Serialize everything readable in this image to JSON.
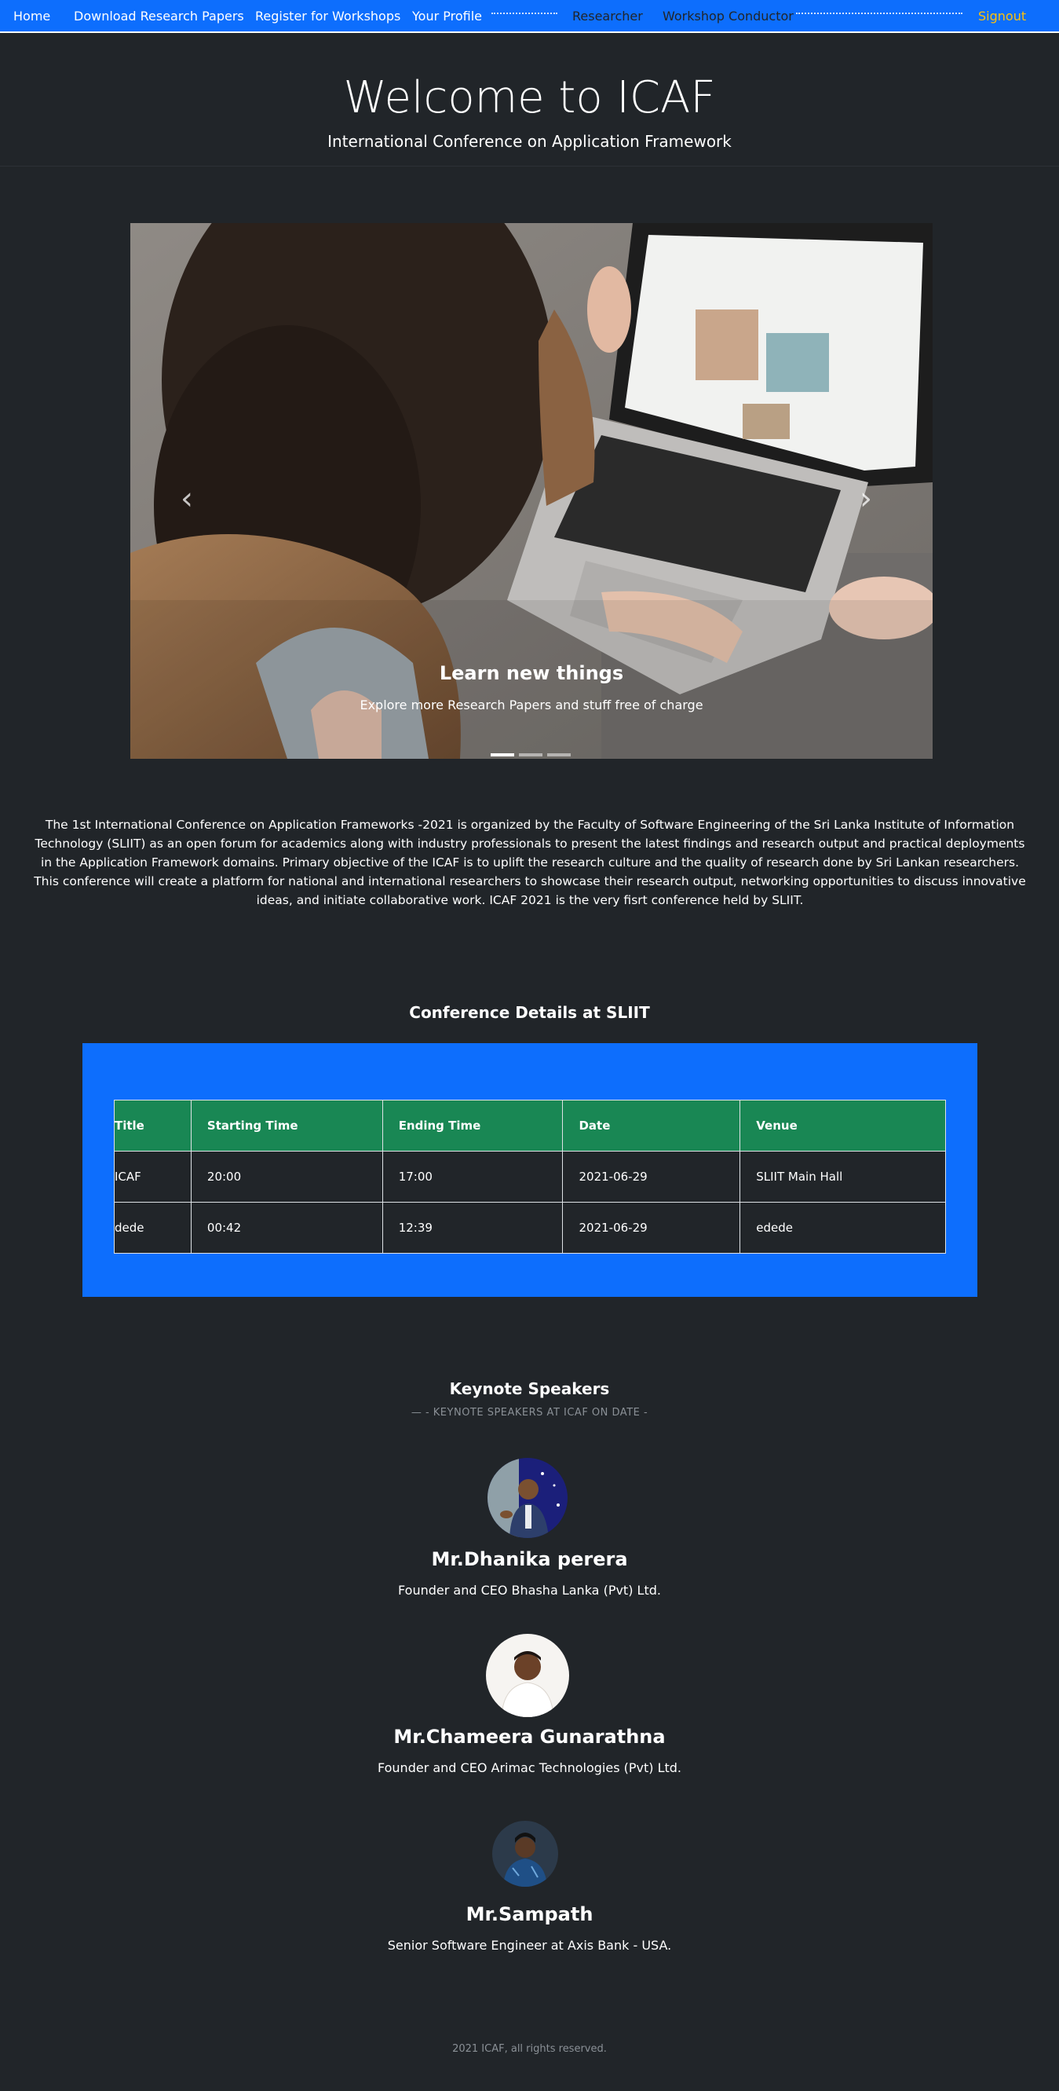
{
  "nav": {
    "home": "Home",
    "download": "Download Research Papers",
    "register": "Register for Workshops",
    "profile": "Your Profile",
    "researcher": "Researcher",
    "conductor": "Workshop Conductor",
    "signout": "Signout"
  },
  "hero": {
    "title": "Welcome to ICAF",
    "subtitle": "International Conference on Application Framework"
  },
  "carousel": {
    "caption_title": "Learn new things",
    "caption_text": "Explore more Research Papers and stuff free of charge",
    "prev_icon": "‹",
    "next_icon": "›",
    "active_index": 0,
    "slide_count": 3
  },
  "intro": "The 1st International Conference on Application Frameworks -2021 is organized by the Faculty of Software Engineering of the Sri Lanka Institute of Information Technology (SLIIT) as an open forum for academics along with industry professionals to present the latest findings and research output and practical deployments in the Application Framework domains. Primary objective of the ICAF is to uplift the research culture and the quality of research done by Sri Lankan researchers. This conference will create a platform for national and international researchers to showcase their research output, networking opportunities to discuss innovative ideas, and initiate collaborative work. ICAF 2021 is the very fisrt conference held by SLIIT.",
  "conference": {
    "title": "Conference Details at SLIIT",
    "headers": [
      "Title",
      "Starting Time",
      "Ending Time",
      "Date",
      "Venue"
    ],
    "rows": [
      [
        "ICAF",
        "20:00",
        "17:00",
        "2021-06-29",
        "SLIIT Main Hall"
      ],
      [
        "dede",
        "00:42",
        "12:39",
        "2021-06-29",
        "edede"
      ]
    ]
  },
  "keynote": {
    "title": "Keynote Speakers",
    "subtitle": "— - KEYNOTE SPEAKERS AT ICAF ON DATE -",
    "speakers": [
      {
        "name": "Mr.Dhanika perera",
        "role": "Founder and CEO Bhasha Lanka (Pvt) Ltd."
      },
      {
        "name": "Mr.Chameera Gunarathna",
        "role": "Founder and CEO Arimac Technologies (Pvt) Ltd."
      },
      {
        "name": "Mr.Sampath",
        "role": "Senior Software Engineer at Axis Bank - USA."
      }
    ]
  },
  "footer": "2021 ICAF, all rights reserved.",
  "colors": {
    "navbar": "#0d6efd",
    "background": "#212529",
    "table_header": "#198754",
    "signout": "#ffc107"
  }
}
